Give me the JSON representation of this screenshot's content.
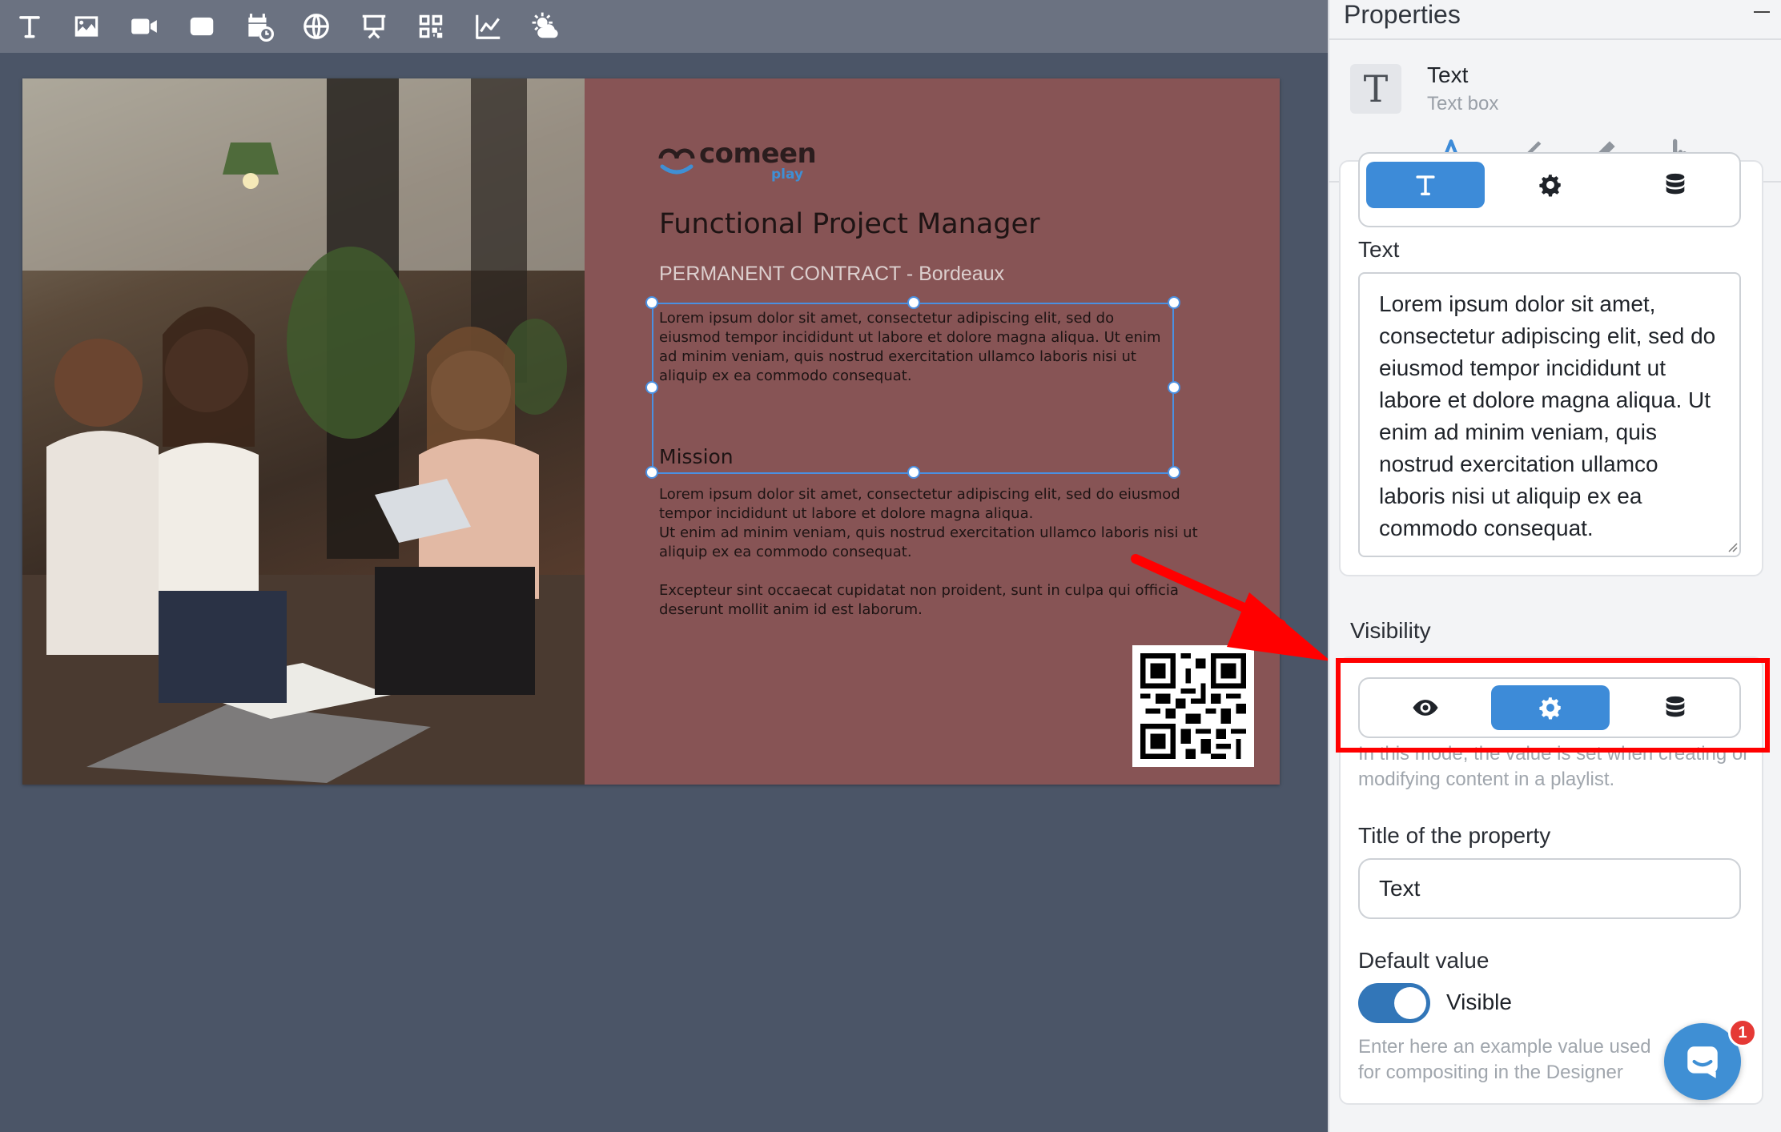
{
  "toolbar": {
    "tools": [
      "text-tool",
      "image-tool",
      "video-tool",
      "shape-tool",
      "calendar-tool",
      "web-tool",
      "presentation-tool",
      "qr-code-tool",
      "chart-tool",
      "weather-tool"
    ]
  },
  "slide": {
    "logo_word": "comeen",
    "logo_sub": "play",
    "job_title": "Functional Project Manager",
    "job_subtitle": "PERMANENT CONTRACT - Bordeaux",
    "body_text": "Lorem ipsum dolor sit amet, consectetur adipiscing elit, sed do eiusmod tempor incididunt ut labore et dolore magna aliqua. Ut enim ad minim veniam, quis nostrud exercitation ullamco laboris nisi ut aliquip ex ea commodo consequat.",
    "mission_heading": "Mission",
    "mission_text": "Lorem ipsum dolor sit amet, consectetur adipiscing elit, sed do eiusmod tempor incididunt ut labore et dolore magna aliqua.\nUt enim ad minim veniam, quis nostrud exercitation ullamco laboris nisi ut aliquip ex ea commodo consequat.\n\nExcepteur sint occaecat cupidatat non proident, sunt in culpa qui officia deserunt mollit anim id est laborum."
  },
  "panel": {
    "title": "Properties",
    "element_name": "Text",
    "element_type": "Text box",
    "text_label": "Text",
    "text_value": "Lorem ipsum dolor sit amet, consectetur adipiscing elit, sed do eiusmod tempor incididunt ut labore et dolore magna aliqua. Ut enim ad minim veniam, quis nostrud exercitation ullamco laboris nisi ut aliquip ex ea commodo consequat.",
    "visibility_label": "Visibility",
    "visibility_help": "In this mode, the value is set when creating or modifying content in a playlist.",
    "property_title_label": "Title of the property",
    "property_title_value": "Text",
    "default_value_label": "Default value",
    "toggle_label": "Visible",
    "toggle_on": true,
    "example_help": "Enter here an example value used for compositing in the Designer",
    "chat_badge": "1"
  },
  "colors": {
    "accent": "#3d8bd8",
    "slide_bg": "#875455",
    "annotation": "#ff0000"
  }
}
